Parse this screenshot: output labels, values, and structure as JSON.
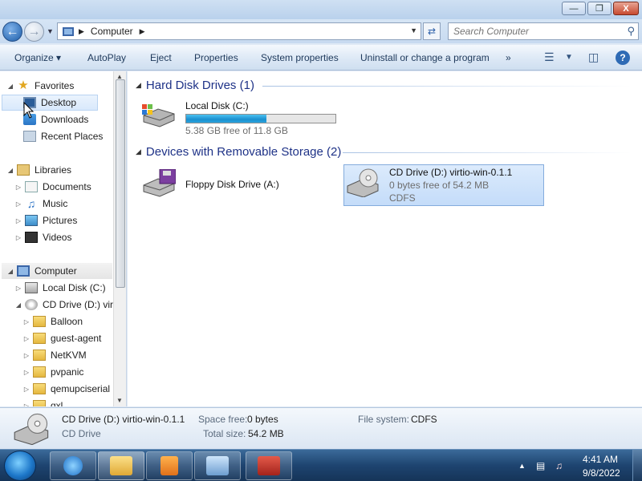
{
  "window": {
    "minimize": "—",
    "maximize": "❐",
    "close": "X"
  },
  "address": {
    "crumb": "Computer",
    "search_placeholder": "Search Computer"
  },
  "toolbar": {
    "organize": "Organize ▾",
    "autoplay": "AutoPlay",
    "eject": "Eject",
    "properties": "Properties",
    "system_properties": "System properties",
    "uninstall": "Uninstall or change a program",
    "more": "»"
  },
  "nav": {
    "favorites": "Favorites",
    "desktop": "Desktop",
    "downloads": "Downloads",
    "recent_places": "Recent Places",
    "libraries": "Libraries",
    "documents": "Documents",
    "music": "Music",
    "pictures": "Pictures",
    "videos": "Videos",
    "computer": "Computer",
    "local_disk": "Local Disk (C:)",
    "cd_drive": "CD Drive (D:) virt",
    "folders": [
      "Balloon",
      "guest-agent",
      "NetKVM",
      "pvpanic",
      "qemupciserial",
      "qxl"
    ]
  },
  "content": {
    "hdd_group": "Hard Disk Drives (1)",
    "removable_group": "Devices with Removable Storage (2)",
    "local_disk": {
      "name": "Local Disk (C:)",
      "free": "5.38 GB free of 11.8 GB",
      "used_fraction": 0.54
    },
    "floppy": {
      "name": "Floppy Disk Drive (A:)"
    },
    "cd": {
      "name": "CD Drive (D:) virtio-win-0.1.1",
      "free": "0 bytes free of 54.2 MB",
      "fs": "CDFS"
    }
  },
  "details": {
    "name": "CD Drive (D:) virtio-win-0.1.1",
    "type": "CD Drive",
    "space_free_label": "Space free:",
    "space_free": "0 bytes",
    "total_size_label": "Total size:",
    "total_size": "54.2 MB",
    "fs_label": "File system:",
    "fs": "CDFS"
  },
  "taskbar": {
    "time": "4:41 AM",
    "date": "9/8/2022"
  }
}
